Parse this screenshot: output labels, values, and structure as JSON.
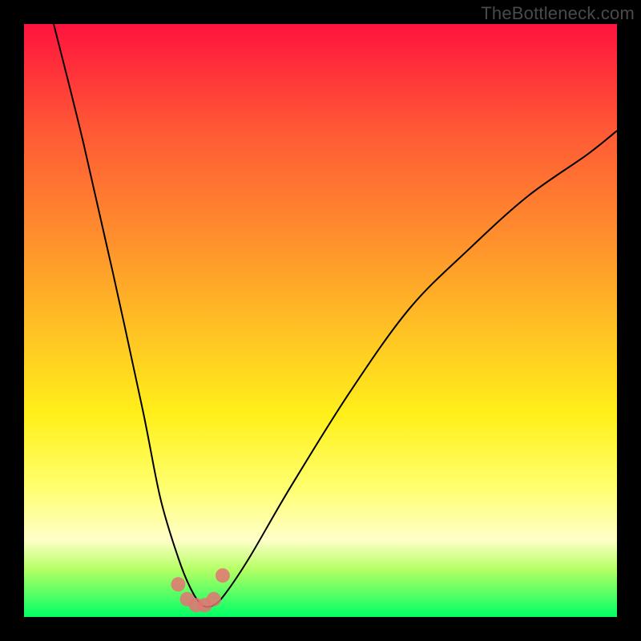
{
  "watermark": "TheBottleneck.com",
  "chart_data": {
    "type": "line",
    "title": "",
    "xlabel": "",
    "ylabel": "",
    "xlim": [
      0,
      100
    ],
    "ylim": [
      0,
      100
    ],
    "background_gradient": {
      "top_color": "#ff143e",
      "bottom_color": "#00ff66"
    },
    "series": [
      {
        "name": "bottleneck-curve",
        "x": [
          5,
          10,
          15,
          20,
          23,
          26,
          28,
          30,
          32,
          34,
          38,
          45,
          55,
          65,
          75,
          85,
          95,
          100
        ],
        "y": [
          100,
          80,
          58,
          35,
          20,
          10,
          5,
          2,
          2,
          4,
          10,
          22,
          38,
          52,
          62,
          71,
          78,
          82
        ]
      }
    ],
    "markers": {
      "name": "minimum-cluster",
      "x": [
        26.0,
        27.5,
        29.0,
        30.5,
        32.0,
        33.5
      ],
      "y": [
        5.5,
        3.0,
        2.0,
        2.0,
        3.0,
        7.0
      ],
      "color": "#e57373",
      "radius": 9
    }
  }
}
